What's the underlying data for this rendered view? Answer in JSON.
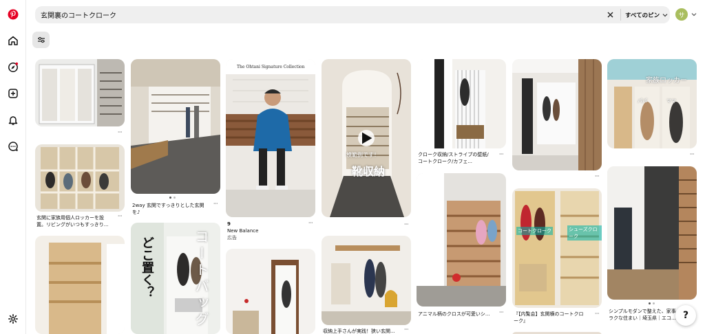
{
  "search": {
    "query": "玄関裏のコートクローク",
    "filter_label": "すべてのピン"
  },
  "account": {
    "avatar_letter": "サ"
  },
  "colors": {
    "brand": "#e60023",
    "search_bg": "#efefef",
    "avatar": "#a9be5e"
  },
  "sidebar": {
    "icons": [
      "pinterest-logo",
      "home-icon",
      "explore-icon",
      "create-icon",
      "notifications-icon",
      "messages-icon",
      "settings-icon"
    ]
  },
  "pins": {
    "p1": {
      "title": ""
    },
    "p2": {
      "title": "玄関に家族用個人ロッカーを設置。リビングがいつもすっきり..."
    },
    "p4": {
      "title": "2way 玄関ですっきりとした玄関を♪"
    },
    "p5": {
      "overlay_vertical": "コートバッグ",
      "overlay_question": "どこ置く？"
    },
    "p6": {
      "brand_banner": "The Ohtani Signature Collection",
      "count": "9",
      "title": "New Balance",
      "sub": "広告"
    },
    "p8": {
      "overlay_top": "模範例です！",
      "overlay_main": "靴収納"
    },
    "p9": {
      "title": "収納上手さんが実践！狭い玄関..."
    },
    "p10": {
      "title": "クローク収納/ストライプの壁紙/コートクローク/カフェ..."
    },
    "p11": {
      "title": "アニマル柄のクロスが可愛いシ..."
    },
    "p13": {
      "label_left": "コートクローク",
      "label_right": "シューズクローク",
      "title": "『【内覧会】玄関横のコートクローク』"
    },
    "p14": {
      "overlay": "家族ロッカー",
      "tag1": "パパ",
      "tag2": "ママ"
    },
    "p15": {
      "title": "シンプルモダンで整えた、家事ラクな住まい｜埼玉県｜エコ..."
    }
  },
  "help": {
    "label": "?"
  }
}
